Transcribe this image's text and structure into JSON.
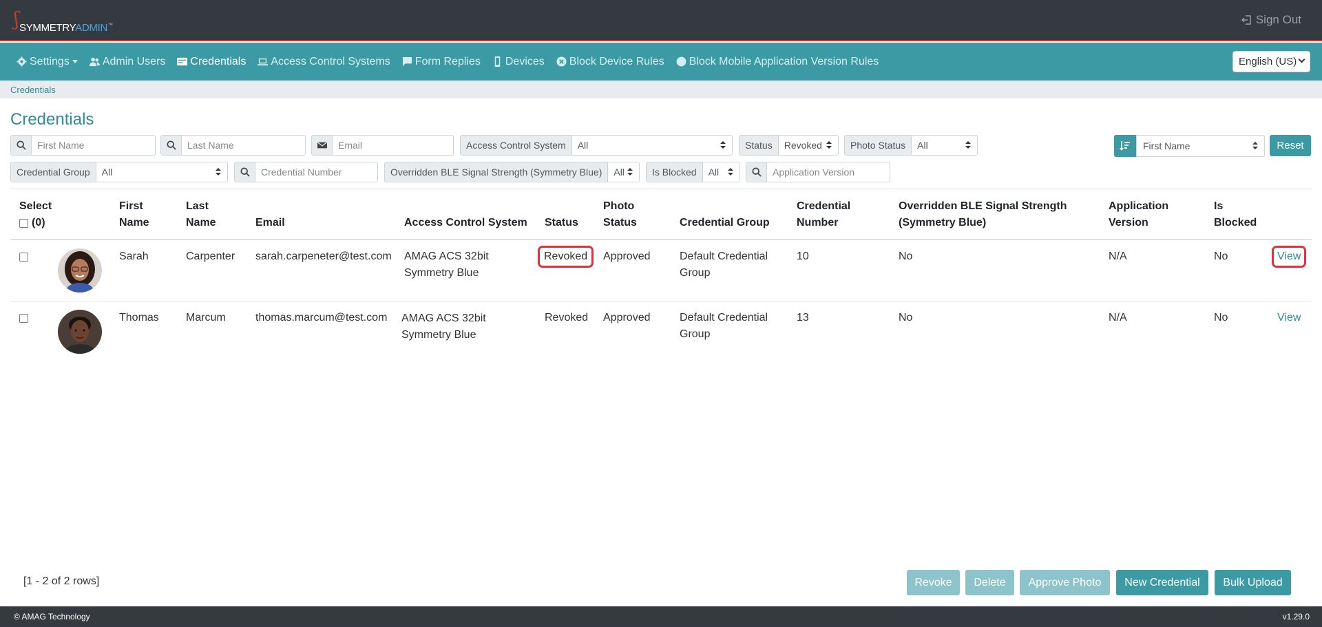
{
  "brand": {
    "part1": "SYMMETRY",
    "part2": "ADMIN"
  },
  "header": {
    "signout_label": "Sign Out"
  },
  "nav": {
    "items": [
      {
        "label": "Settings"
      },
      {
        "label": "Admin Users"
      },
      {
        "label": "Credentials"
      },
      {
        "label": "Access Control Systems"
      },
      {
        "label": "Form Replies"
      },
      {
        "label": "Devices"
      },
      {
        "label": "Block Device Rules"
      },
      {
        "label": "Block Mobile Application Version Rules"
      }
    ],
    "language": "English (US)"
  },
  "breadcrumb": "Credentials",
  "page_title": "Credentials",
  "filters": {
    "first_name_ph": "First Name",
    "last_name_ph": "Last Name",
    "email_ph": "Email",
    "acs_label": "Access Control System",
    "acs_value": "All",
    "status_label": "Status",
    "status_value": "Revoked",
    "photo_status_label": "Photo Status",
    "photo_status_value": "All",
    "sort_value": "First Name",
    "reset_label": "Reset",
    "cred_group_label": "Credential Group",
    "cred_group_value": "All",
    "cred_number_ph": "Credential Number",
    "ble_label": "Overridden BLE Signal Strength (Symmetry Blue)",
    "ble_value": "All",
    "blocked_label": "Is Blocked",
    "blocked_value": "All",
    "app_version_ph": "Application Version"
  },
  "table": {
    "headers": {
      "select": "Select",
      "select_count": "(0)",
      "first1": "First",
      "first2": "Name",
      "last1": "Last",
      "last2": "Name",
      "email": "Email",
      "acs": "Access Control System",
      "status": "Status",
      "photo1": "Photo",
      "photo2": "Status",
      "group": "Credential Group",
      "cred1": "Credential",
      "cred2": "Number",
      "ble1": "Overridden BLE Signal Strength",
      "ble2": "(Symmetry Blue)",
      "app1": "Application",
      "app2": "Version",
      "blk1": "Is",
      "blk2": "Blocked"
    },
    "rows": [
      {
        "first": "Sarah",
        "last": "Carpenter",
        "email": "sarah.carpeneter@test.com",
        "acs1": "AMAG ACS 32bit",
        "acs2": "Symmetry Blue",
        "status": "Revoked",
        "photo": "Approved",
        "group1": "Default Credential",
        "group2": "Group",
        "number": "10",
        "ble": "No",
        "app": "N/A",
        "blocked": "No",
        "action": "View"
      },
      {
        "first": "Thomas",
        "last": "Marcum",
        "email": "thomas.marcum@test.com",
        "acs1": "AMAG ACS 32bit",
        "acs2": "Symmetry Blue",
        "status": "Revoked",
        "photo": "Approved",
        "group1": "Default Credential",
        "group2": "Group",
        "number": "13",
        "ble": "No",
        "app": "N/A",
        "blocked": "No",
        "action": "View"
      }
    ]
  },
  "rows_info": "[1 - 2 of 2 rows]",
  "actions": {
    "revoke": "Revoke",
    "delete": "Delete",
    "approve_photo": "Approve Photo",
    "new_credential": "New Credential",
    "bulk_upload": "Bulk Upload"
  },
  "footer": {
    "copyright": "© AMAG Technology",
    "version": "v1.29.0"
  },
  "colors": {
    "primary": "#3c9aa5",
    "dark": "#343a40",
    "highlight": "#e0323c"
  }
}
